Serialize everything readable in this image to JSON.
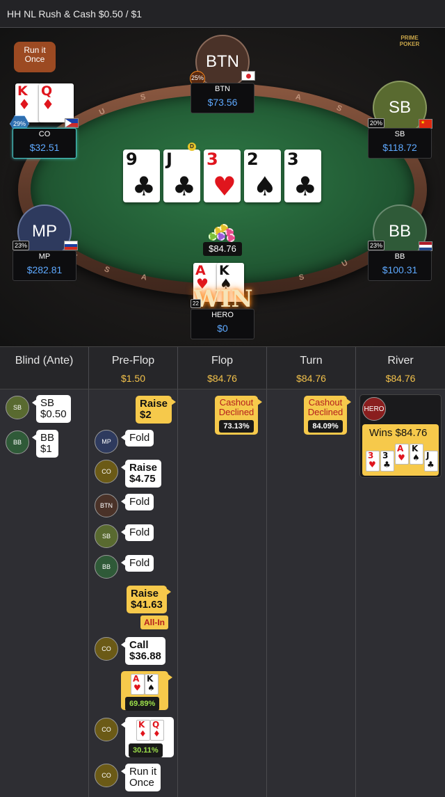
{
  "title": "HH NL Rush & Cash $0.50 / $1",
  "logo": "PRIME POKER",
  "run_it_once_bubble": "Run it Once",
  "dealer_label": "D",
  "board": [
    {
      "rank": "9",
      "suit": "♣",
      "color": "black"
    },
    {
      "rank": "J",
      "suit": "♣",
      "color": "black"
    },
    {
      "rank": "3",
      "suit": "♥",
      "color": "red"
    },
    {
      "rank": "2",
      "suit": "♠",
      "color": "black"
    },
    {
      "rank": "3",
      "suit": "♣",
      "color": "black"
    }
  ],
  "pot": "$84.76",
  "win_label": "WIN",
  "rail_letters": [
    "S",
    "U",
    "S",
    "A",
    "S",
    "U",
    "S",
    "A",
    "S",
    "U",
    "S",
    "A"
  ],
  "players": {
    "btn": {
      "avatar": "BTN",
      "name": "BTN",
      "stack": "$73.56",
      "pct": "25%"
    },
    "co": {
      "name": "CO",
      "stack": "$32.51",
      "pct": "29%",
      "cards": [
        {
          "rank": "K",
          "suit": "♦"
        },
        {
          "rank": "Q",
          "suit": "♦"
        }
      ]
    },
    "sb": {
      "avatar": "SB",
      "name": "SB",
      "stack": "$118.72",
      "pct": "20%"
    },
    "mp": {
      "avatar": "MP",
      "name": "MP",
      "stack": "$282.81",
      "pct": "23%"
    },
    "bb": {
      "avatar": "BB",
      "name": "BB",
      "stack": "$100.31",
      "pct": "23%"
    },
    "hero": {
      "name": "HERO",
      "stack": "$0",
      "pct": "22",
      "cards": [
        {
          "rank": "A",
          "suit": "♥",
          "color": "red"
        },
        {
          "rank": "K",
          "suit": "♠",
          "color": "black"
        }
      ]
    }
  },
  "columns": [
    {
      "title": "Blind (Ante)",
      "value": ""
    },
    {
      "title": "Pre-Flop",
      "value": "$1.50"
    },
    {
      "title": "Flop",
      "value": "$84.76"
    },
    {
      "title": "Turn",
      "value": "$84.76"
    },
    {
      "title": "River",
      "value": "$84.76"
    }
  ],
  "blind_actions": [
    {
      "pos": "SB",
      "line1": "SB",
      "line2": "$0.50"
    },
    {
      "pos": "BB",
      "line1": "BB",
      "line2": "$1"
    }
  ],
  "preflop": {
    "hero_raise": {
      "line1": "Raise",
      "line2": "$2"
    },
    "mp": {
      "pos": "MP",
      "text": "Fold"
    },
    "co_raise": {
      "pos": "CO",
      "line1": "Raise",
      "line2": "$4.75"
    },
    "btn": {
      "pos": "BTN",
      "text": "Fold"
    },
    "sb": {
      "pos": "SB",
      "text": "Fold"
    },
    "bb": {
      "pos": "BB",
      "text": "Fold"
    },
    "hero_allin": {
      "line1": "Raise",
      "line2": "$41.63",
      "tag": "All-In"
    },
    "co_call": {
      "pos": "CO",
      "line1": "Call",
      "line2": "$36.88"
    },
    "hero_equity": {
      "cards": [
        {
          "rank": "A",
          "suit": "♥",
          "color": "red"
        },
        {
          "rank": "K",
          "suit": "♠",
          "color": "black"
        }
      ],
      "pct": "69.89%"
    },
    "co_equity": {
      "pos": "CO",
      "cards": [
        {
          "rank": "K",
          "suit": "♦",
          "color": "red"
        },
        {
          "rank": "Q",
          "suit": "♦",
          "color": "red"
        }
      ],
      "pct": "30.11%"
    },
    "co_rio": {
      "pos": "CO",
      "line1": "Run it",
      "line2": "Once"
    }
  },
  "flop": {
    "line1": "Cashout",
    "line2": "Declined",
    "pct": "73.13%"
  },
  "turn": {
    "line1": "Cashout",
    "line2": "Declined",
    "pct": "84.09%"
  },
  "river": {
    "pos": "HERO",
    "wins": "Wins $84.76",
    "cards": [
      {
        "rank": "3",
        "suit": "♥",
        "color": "red"
      },
      {
        "rank": "3",
        "suit": "♣",
        "color": "black"
      },
      {
        "rank": "A",
        "suit": "♥",
        "color": "red"
      },
      {
        "rank": "K",
        "suit": "♠",
        "color": "black"
      },
      {
        "rank": "J",
        "suit": "♣",
        "color": "black"
      }
    ]
  }
}
